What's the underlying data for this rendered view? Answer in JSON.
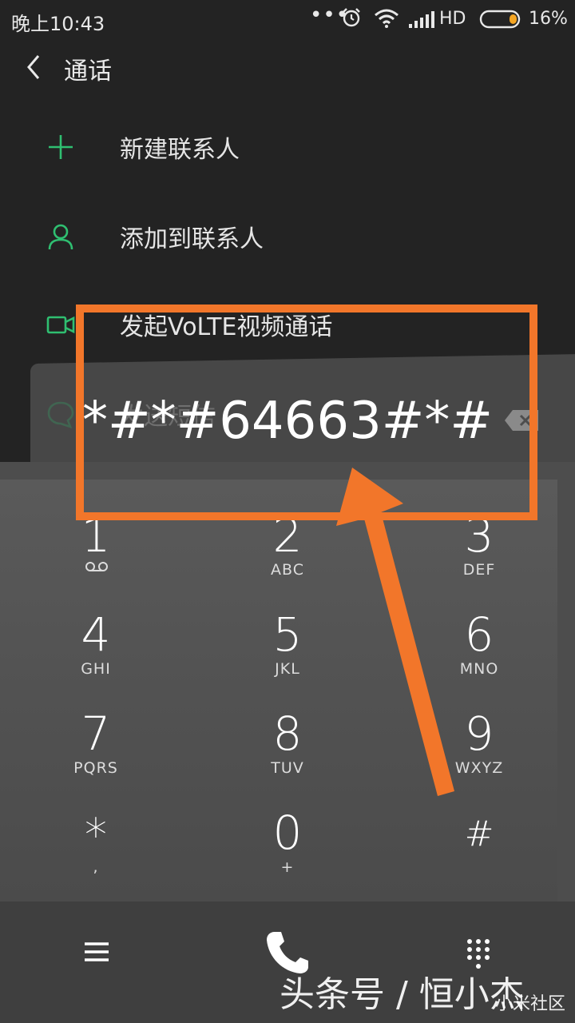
{
  "status_bar": {
    "time": "晚上10:43",
    "dots": "•••",
    "network": "HD",
    "battery": "16%"
  },
  "header": {
    "title": "通话"
  },
  "menu": [
    {
      "label": "新建联系人",
      "icon": "plus-icon"
    },
    {
      "label": "添加到联系人",
      "icon": "person-icon"
    },
    {
      "label": "发起VoLTE视频通话",
      "icon": "video-call-icon"
    },
    {
      "label": "发送短信",
      "icon": "message-icon"
    }
  ],
  "dialer": {
    "number": "*#*#64663#*#",
    "keys": [
      {
        "digit": "1",
        "letters": ""
      },
      {
        "digit": "2",
        "letters": "ABC"
      },
      {
        "digit": "3",
        "letters": "DEF"
      },
      {
        "digit": "4",
        "letters": "GHI"
      },
      {
        "digit": "5",
        "letters": "JKL"
      },
      {
        "digit": "6",
        "letters": "MNO"
      },
      {
        "digit": "7",
        "letters": "PQRS"
      },
      {
        "digit": "8",
        "letters": "TUV"
      },
      {
        "digit": "9",
        "letters": "WXYZ"
      },
      {
        "digit": "*",
        "letters": ","
      },
      {
        "digit": "0",
        "letters": "+"
      },
      {
        "digit": "#",
        "letters": ""
      }
    ]
  },
  "colors": {
    "accent": "#2fbf71",
    "annotation": "#f2762a",
    "background": "#232323",
    "panel": "#4d4d4d"
  },
  "watermark": {
    "main": "头条号 / 恒小杰",
    "sub": "小米社区"
  }
}
